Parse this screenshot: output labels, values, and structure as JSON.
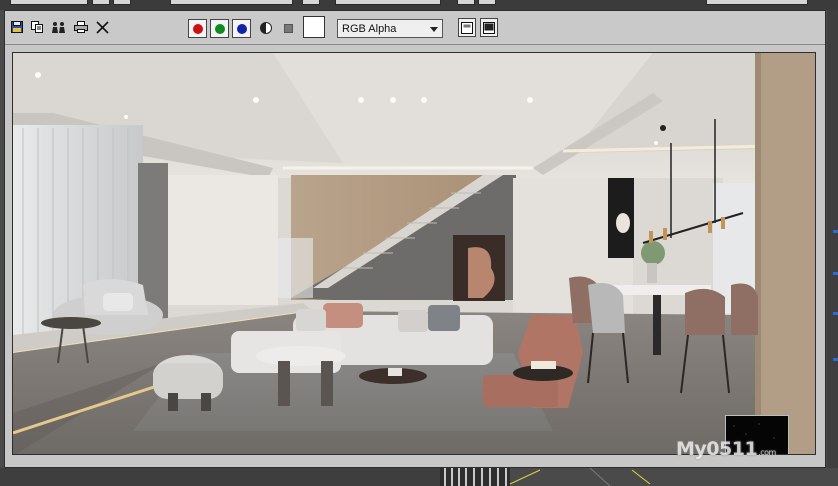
{
  "toolbar": {
    "icons": [
      "save-icon",
      "copy-icon",
      "clone-icon",
      "print-icon",
      "clear-icon"
    ],
    "channels": {
      "red": "#cc1111",
      "green": "#118a22",
      "blue": "#1122aa"
    },
    "channel_select": "RGB Alpha"
  },
  "watermark": {
    "text": "My0511",
    "suffix": ".com"
  }
}
